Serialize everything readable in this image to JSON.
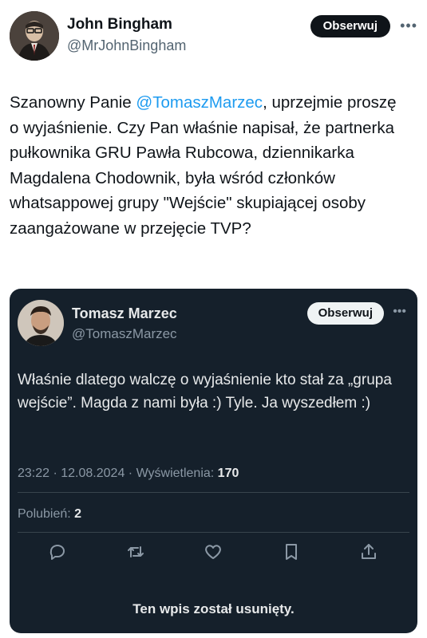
{
  "author": {
    "display_name": "John Bingham",
    "handle": "@MrJohnBingham",
    "follow_label": "Obserwuj"
  },
  "tweet": {
    "text_before": "Szanowny Panie ",
    "mention": "@TomaszMarzec",
    "text_after": ", uprzejmie proszę o wyjaśnienie. Czy Pan właśnie napisał, że partnerka pułkownika GRU Pawła Rubcowa, dziennikarka Magdalena Chodownik, była wśród członków whatsappowej grupy \"Wejście\" skupiającej osoby zaangażowane w przejęcie TVP?"
  },
  "quote": {
    "display_name": "Tomasz Marzec",
    "handle": "@TomaszMarzec",
    "follow_label": "Obserwuj",
    "text": "Właśnie dlatego walczę o wyjaśnienie kto stał za „grupa wejście”. Magda z nami była :) Tyle. Ja wyszedłem :)",
    "time_date": "23:22 · 12.08.2024 · ",
    "views_label": "Wyświetlenia: ",
    "views_count": "170",
    "likes_label": "Polubień: ",
    "likes_count": "2",
    "deleted_notice": "Ten wpis został usunięty."
  },
  "icons": {
    "reply": "reply-icon",
    "retweet": "retweet-icon",
    "like": "heart-icon",
    "bookmark": "bookmark-icon",
    "share": "share-icon",
    "more": "more-icon"
  },
  "colors": {
    "mention": "#1d9bf0",
    "card_bg": "#15202b",
    "follow_dark": "#0f1419"
  }
}
